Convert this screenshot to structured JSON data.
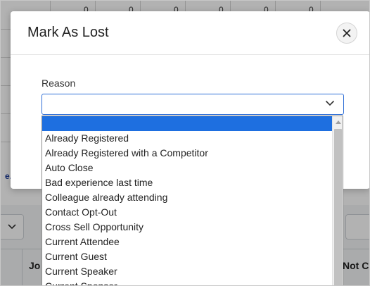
{
  "background": {
    "grid_digits": [
      "0",
      "0",
      "0",
      "0",
      "0",
      "0"
    ],
    "link_text": "e. I",
    "column_headers": {
      "left": "Jo",
      "right": "Not C"
    }
  },
  "modal": {
    "title": "Mark As Lost",
    "close_icon": "close-icon",
    "field_label": "Reason",
    "selected_value": "",
    "chevron_icon": "chevron-down-icon"
  },
  "dropdown": {
    "highlighted_index": 0,
    "options": [
      "",
      "Already Registered",
      "Already Registered with a Competitor",
      "Auto Close",
      "Bad experience last time",
      "Colleague already attending",
      "Contact Opt-Out",
      "Cross Sell Opportunity",
      "Current Attendee",
      "Current Guest",
      "Current Speaker",
      "Current Sponsor"
    ]
  },
  "colors": {
    "highlight": "#1e6fe0",
    "select_border": "#2f6fd6",
    "overlay": "rgba(0,0,0,0.30)"
  }
}
